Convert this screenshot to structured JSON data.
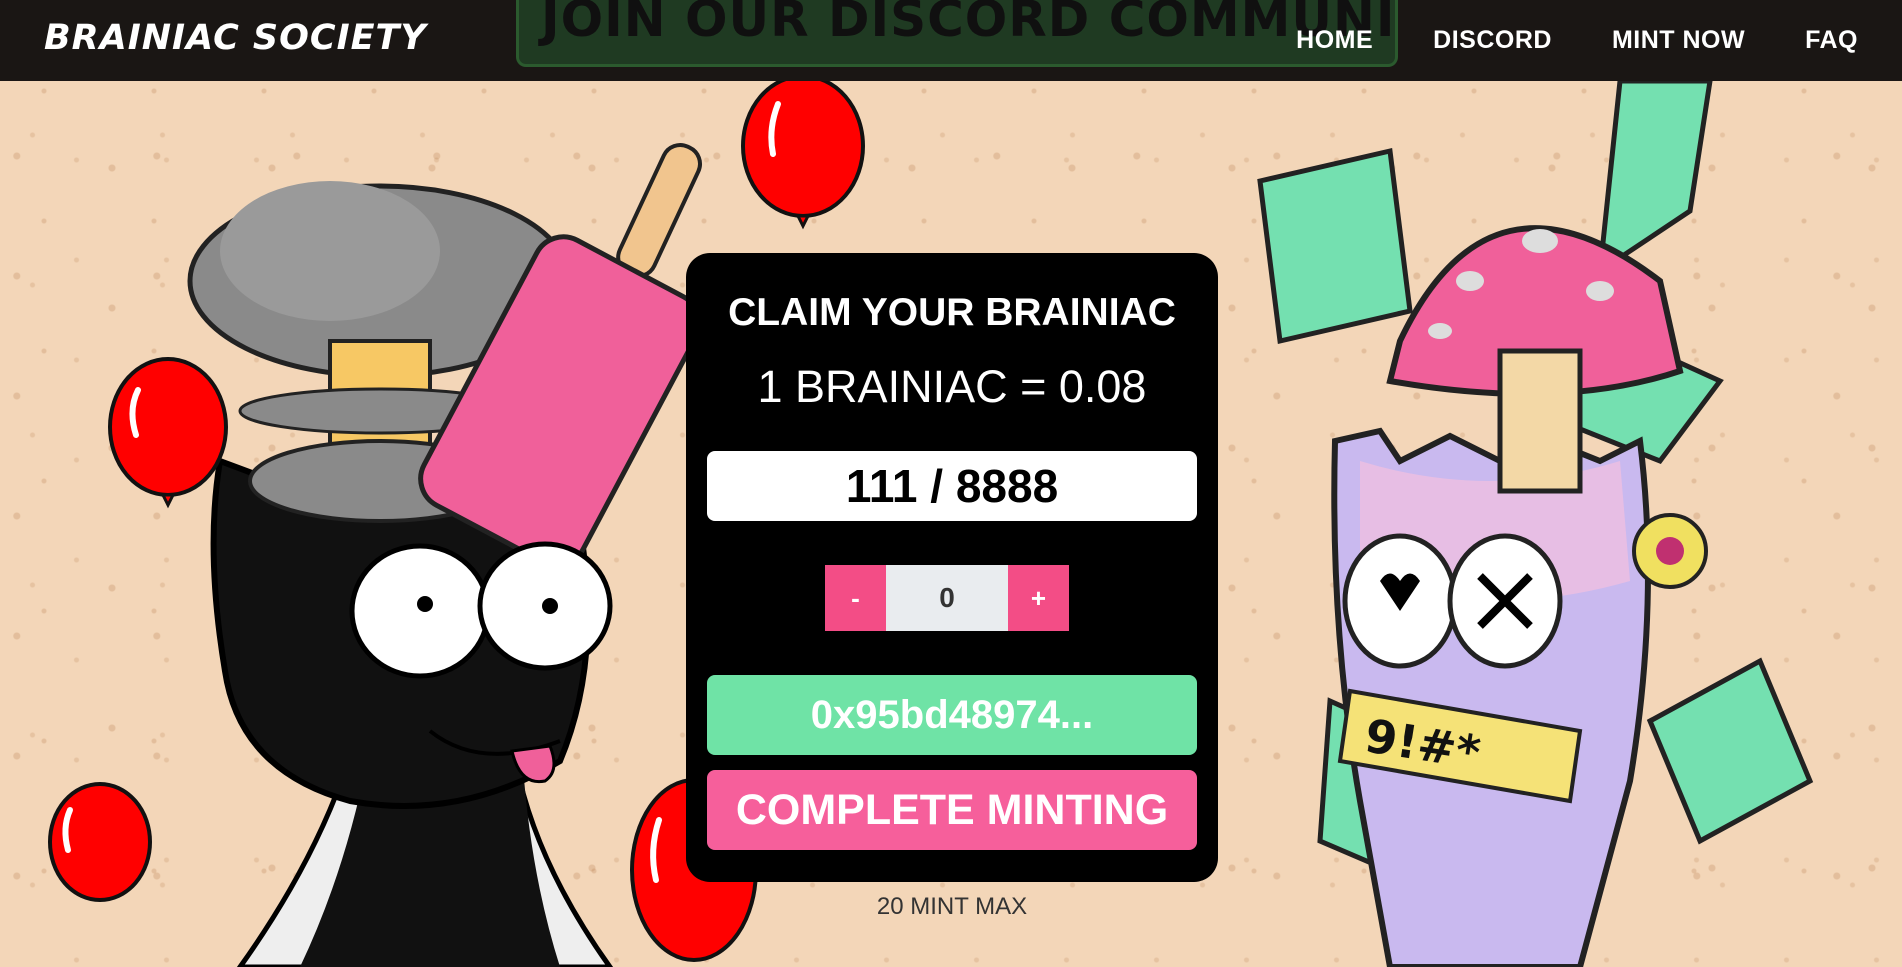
{
  "nav": {
    "brand": "BRAINIAC SOCIETY",
    "banner": "JOIN OUR DISCORD COMMUNITY",
    "links": [
      "HOME",
      "DISCORD",
      "MINT NOW",
      "FAQ"
    ]
  },
  "mint": {
    "title": "CLAIM YOUR BRAINIAC",
    "price": "1 BRAINIAC = 0.08",
    "supply": "111 / 8888",
    "decrement_label": "-",
    "increment_label": "+",
    "quantity": "0",
    "wallet": "0x95bd48974...",
    "complete_label": "COMPLETE MINTING",
    "max_note": "20 MINT MAX"
  },
  "colors": {
    "background": "#f3d6b8",
    "nav": "#1a1614",
    "card": "#000000",
    "pink": "#f34d86",
    "green": "#6fe3a6",
    "balloon": "#ff0000"
  }
}
